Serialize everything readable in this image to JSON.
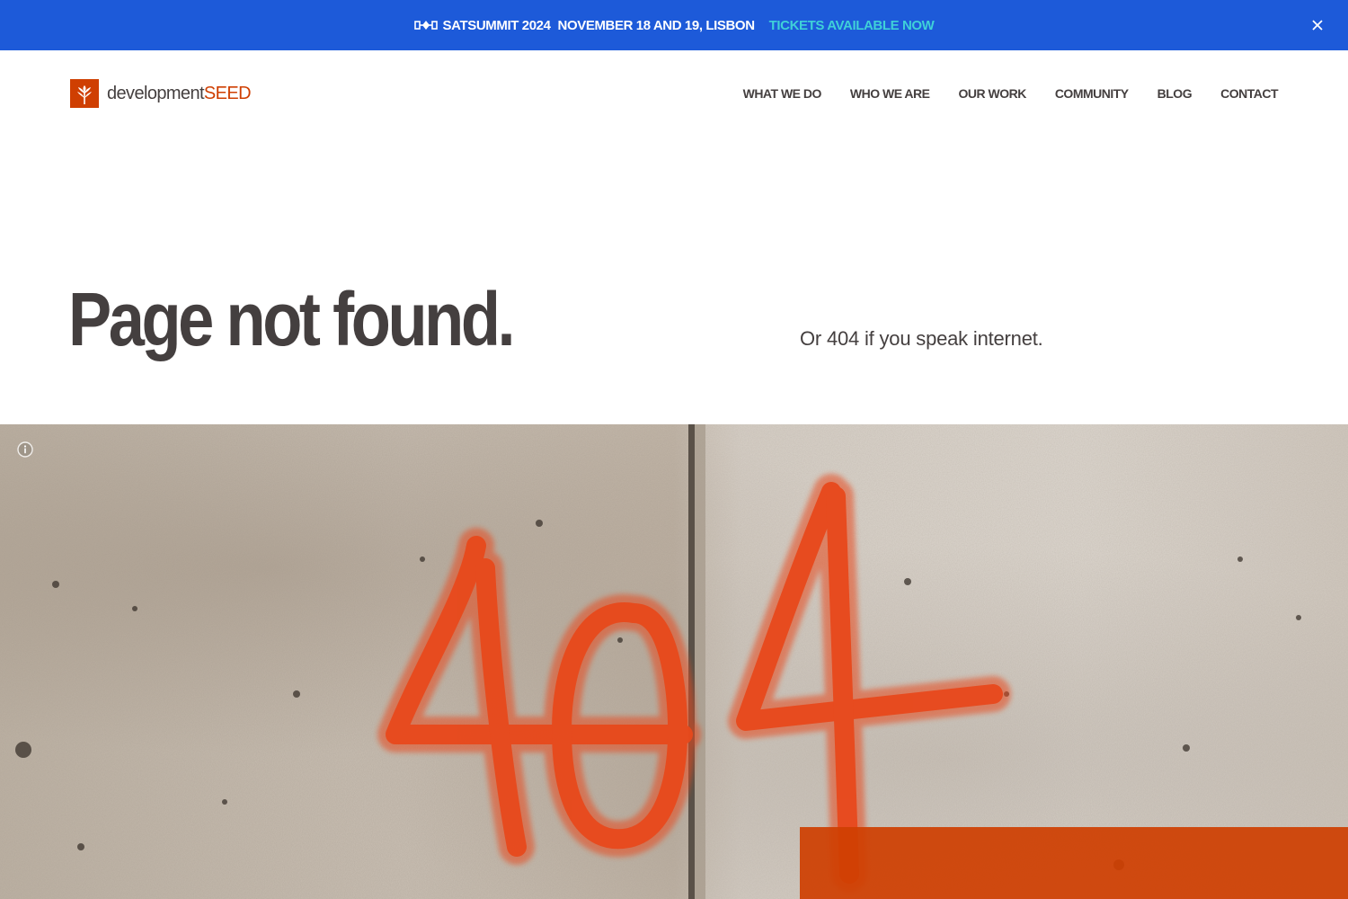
{
  "banner": {
    "logo_icon": "satsummit-logo-icon",
    "title": "SATSUMMIT 2024",
    "date": "NOVEMBER 18 AND 19, LISBON",
    "cta": "TICKETS AVAILABLE NOW",
    "close_icon": "close-icon",
    "background": "#1d5ad9",
    "cta_color": "#3fd0d8"
  },
  "header": {
    "logo": {
      "word": "development",
      "accent": "SEED",
      "icon": "seed-logo-icon",
      "accent_color": "#cf3f02"
    },
    "nav": [
      {
        "label": "WHAT WE DO"
      },
      {
        "label": "WHO WE ARE"
      },
      {
        "label": "OUR WORK"
      },
      {
        "label": "COMMUNITY"
      },
      {
        "label": "BLOG"
      },
      {
        "label": "CONTACT"
      }
    ]
  },
  "hero": {
    "title": "Page not found.",
    "subtitle": "Or 404 if you speak internet."
  },
  "image": {
    "graffiti_text": "404",
    "info_icon": "info-icon",
    "graffiti_color": "#e8491c"
  }
}
